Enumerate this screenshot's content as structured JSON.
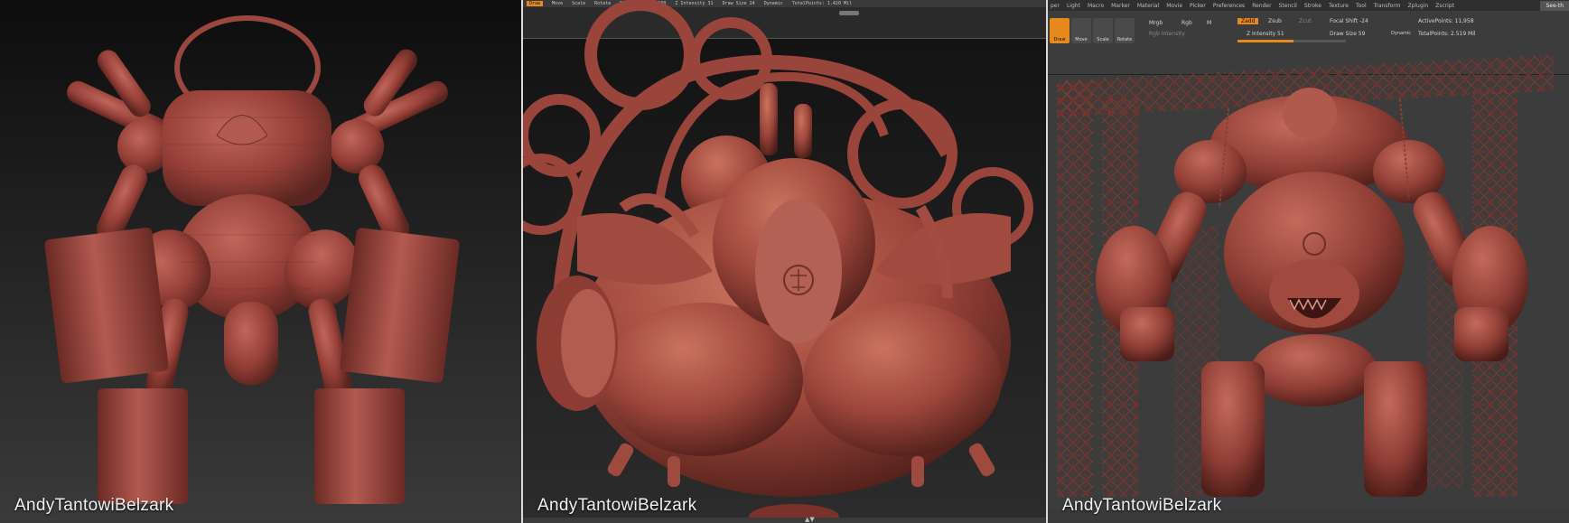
{
  "watermark": "AndyTantowiBelzark",
  "panel2_toolbar": {
    "active_tool": "Draw",
    "items": [
      "Move",
      "Scale",
      "Rotate",
      "Rgb Intensity 100",
      "Z Intensity 31",
      "Draw Size 24",
      "Dynamic",
      "TotalPoints: 1.420 Mil"
    ]
  },
  "panel3_menu": {
    "items": [
      "per",
      "Light",
      "Macro",
      "Marker",
      "Material",
      "Movie",
      "Picker",
      "Preferences",
      "Render",
      "Stencil",
      "Stroke",
      "Texture",
      "Tool",
      "Transform",
      "Zplugin",
      "Zscript"
    ],
    "see_through": "See-th"
  },
  "panel3_toolbar": {
    "buttons": [
      "Draw",
      "Move",
      "Scale",
      "Rotate"
    ],
    "mrgb": "Mrgb",
    "rgb": "Rgb",
    "m": "M",
    "rgb_intensity": "Rgb Intensity",
    "zadd": "Zadd",
    "zsub": "Zsub",
    "zcut": "Zcut",
    "z_intensity": "Z Intensity 51",
    "focal_shift": "Focal Shift -24",
    "draw_size": "Draw Size 59",
    "dynamic": "Dynamic",
    "active_points": "ActivePoints: 11,958",
    "total_points": "TotalPoints: 2.519 Mil"
  },
  "colors": {
    "clay": "#a8534a",
    "clay_dark": "#6e2f29",
    "accent": "#e8891d"
  }
}
